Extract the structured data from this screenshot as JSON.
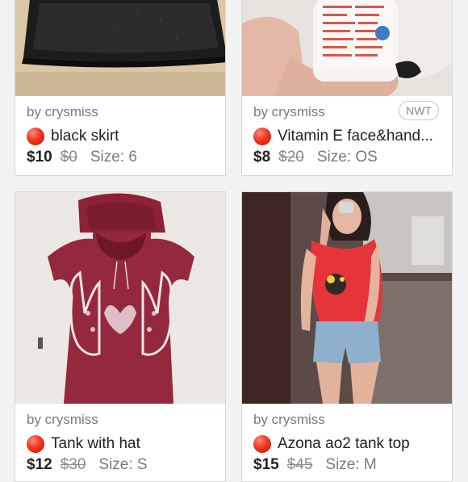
{
  "listings": [
    {
      "seller": "by crysmiss",
      "badge": "",
      "title": "black skirt",
      "price": "$10",
      "original_price": "$0",
      "size": "Size: 6",
      "image": "black-skirt-photo"
    },
    {
      "seller": "by crysmiss",
      "badge": "NWT",
      "title": "Vitamin E face&hand...",
      "price": "$8",
      "original_price": "$20",
      "size": "Size: OS",
      "image": "lotion-bottle-photo"
    },
    {
      "seller": "by crysmiss",
      "badge": "",
      "title": "Tank with hat",
      "price": "$12",
      "original_price": "$30",
      "size": "Size: S",
      "image": "hooded-tank-photo"
    },
    {
      "seller": "by crysmiss",
      "badge": "",
      "title": "Azona ao2 tank top",
      "price": "$15",
      "original_price": "$45",
      "size": "Size: M",
      "image": "red-tank-top-photo"
    }
  ],
  "colors": {
    "background": "#f2f2f2",
    "card": "#ffffff",
    "availability_dot": "#f0361f",
    "seller_text": "#7a7a7a",
    "title_text": "#222222"
  }
}
